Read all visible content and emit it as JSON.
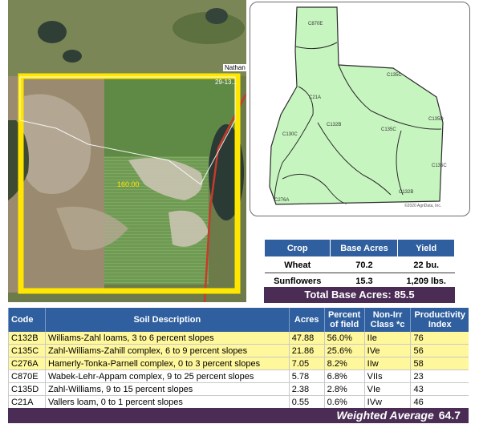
{
  "aerial": {
    "road_label": "Nathan",
    "section_label": "29-13...",
    "acres_label": "160.00"
  },
  "soil_map": {
    "labels": [
      "C870E",
      "C132B",
      "C135C",
      "C135D",
      "C21A",
      "C130C",
      "C135C",
      "C132B",
      "C135C",
      "C276A"
    ],
    "copyright": "©2020 AgriData, Inc."
  },
  "crop_table": {
    "headers": [
      "Crop",
      "Base Acres",
      "Yield"
    ],
    "rows": [
      {
        "crop": "Wheat",
        "base_acres": "70.2",
        "yield": "22 bu."
      },
      {
        "crop": "Sunflowers",
        "base_acres": "15.3",
        "yield": "1,209 lbs."
      }
    ],
    "total_label": "Total Base Acres:",
    "total_value": "85.5"
  },
  "soil_table": {
    "headers": {
      "code": "Code",
      "desc": "Soil Description",
      "acres": "Acres",
      "pct": "Percent of field",
      "class": "Non-Irr Class *c",
      "index": "Productivity Index"
    },
    "rows": [
      {
        "code": "C132B",
        "desc": "Williams-Zahl loams, 3 to 6 percent slopes",
        "acres": "47.88",
        "pct": "56.0%",
        "class": "IIe",
        "index": "76",
        "highlight": true
      },
      {
        "code": "C135C",
        "desc": "Zahl-Williams-Zahill complex, 6 to 9 percent slopes",
        "acres": "21.86",
        "pct": "25.6%",
        "class": "IVe",
        "index": "56",
        "highlight": true
      },
      {
        "code": "C276A",
        "desc": "Hamerly-Tonka-Parnell complex, 0 to 3 percent slopes",
        "acres": "7.05",
        "pct": "8.2%",
        "class": "IIw",
        "index": "58",
        "highlight": true
      },
      {
        "code": "C870E",
        "desc": "Wabek-Lehr-Appam complex, 9 to 25 percent slopes",
        "acres": "5.78",
        "pct": "6.8%",
        "class": "VIIs",
        "index": "23",
        "highlight": false
      },
      {
        "code": "C135D",
        "desc": "Zahl-Williams, 9 to 15 percent slopes",
        "acres": "2.38",
        "pct": "2.8%",
        "class": "VIe",
        "index": "43",
        "highlight": false
      },
      {
        "code": "C21A",
        "desc": "Vallers loam, 0 to 1 percent slopes",
        "acres": "0.55",
        "pct": "0.6%",
        "class": "IVw",
        "index": "46",
        "highlight": false
      }
    ],
    "weighted_label": "Weighted Average",
    "weighted_value": "64.7"
  },
  "colors": {
    "header_blue": "#2f5f9e",
    "total_purple": "#4a2c55",
    "row_highlight": "#fff79b",
    "boundary_yellow": "#ffe600",
    "soil_green": "#c7f5c0"
  }
}
